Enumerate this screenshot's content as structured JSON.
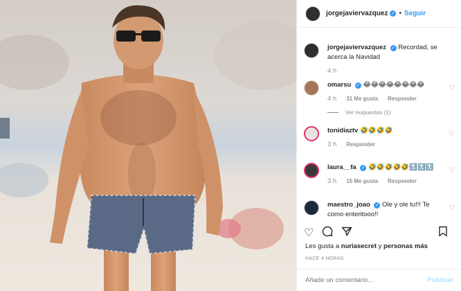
{
  "header": {
    "username": "jorgejaviervazquez",
    "dot": "•",
    "follow_label": "Seguir"
  },
  "caption": {
    "username": "jorgejaviervazquez",
    "text": "Recordad, se acerca la Navidad",
    "time": "4 h"
  },
  "comments": [
    {
      "username": "omarsu",
      "text": "😂😂😂😂😂😂😂😂",
      "time": "4 h",
      "likes": "31 Me gusta",
      "reply": "Responder",
      "view_replies": "Ver respuestas (1)"
    },
    {
      "username": "tonidiaztv",
      "text": "🤣🤣🤣🤣",
      "time": "3 h",
      "reply": "Responder"
    },
    {
      "username": "laura__fa",
      "text": "🤣🤣🤣🤣🤣🔝🔝🔝",
      "time": "3 h",
      "likes": "15 Me gusta",
      "reply": "Responder"
    },
    {
      "username": "maestro_joao",
      "text": "Ole y ole tu!!! Te como enteritooo!!"
    }
  ],
  "likes_line": {
    "prefix": "Les gusta a",
    "user": "nuriasecret",
    "connector": "y",
    "rest": "personas más"
  },
  "posted_time": "HACE 4 HORAS",
  "comment_input": {
    "placeholder": "Añade un comentario..."
  },
  "publish_label": "Publicar",
  "colors": {
    "accent": "#3897f0",
    "muted": "#8e8e8e",
    "publish_disabled": "#b2dffc"
  }
}
